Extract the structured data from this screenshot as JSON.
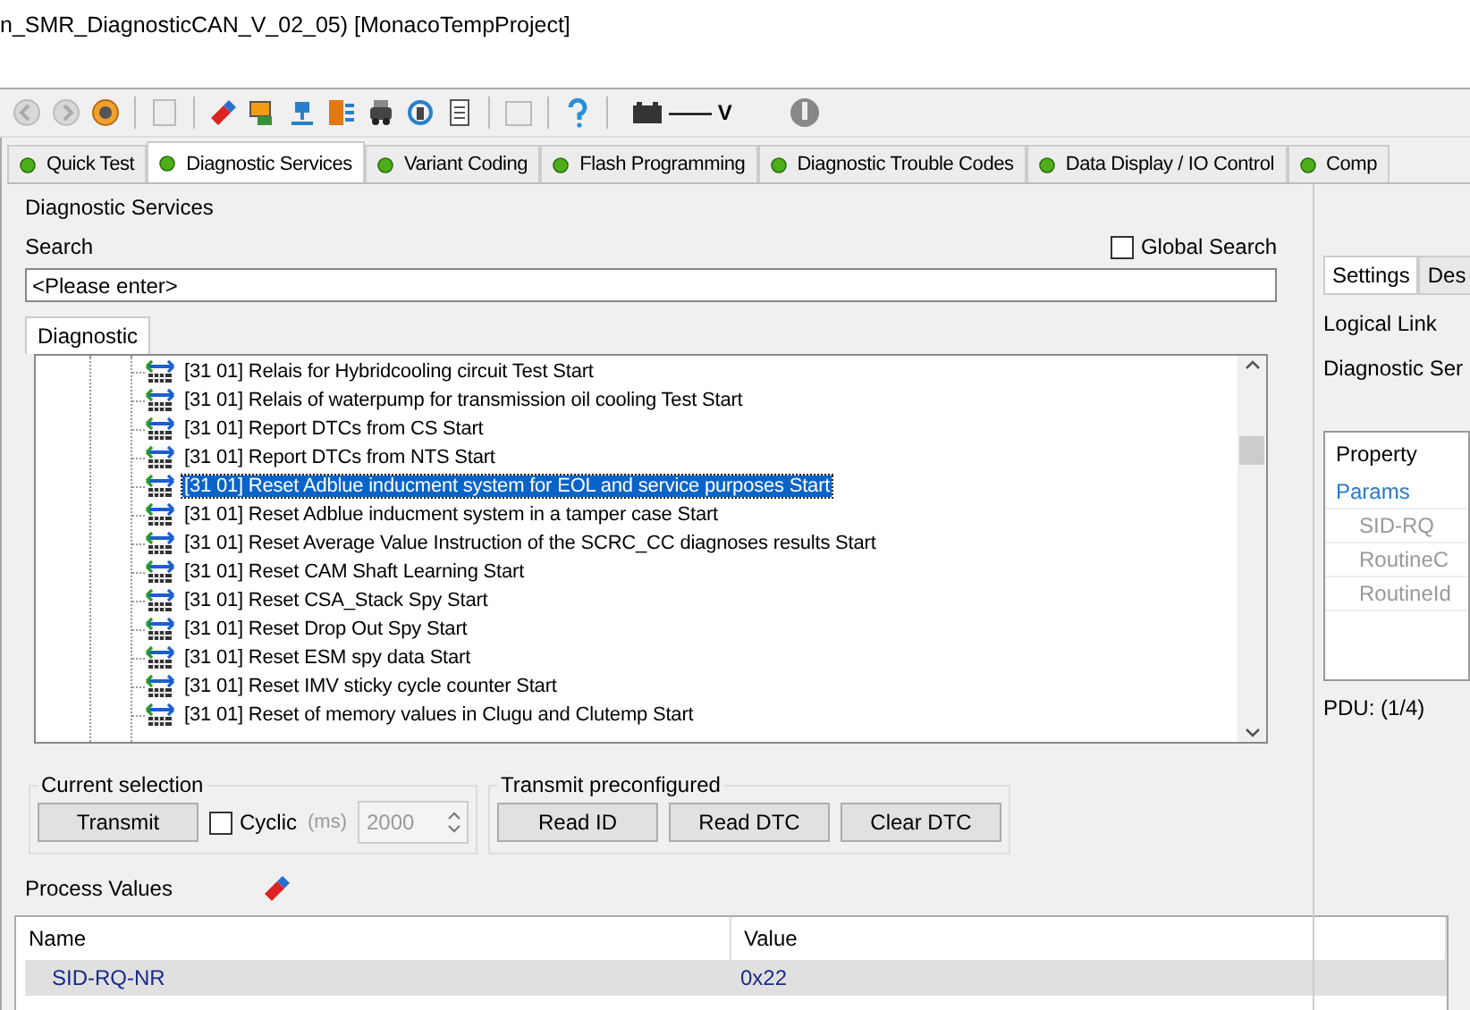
{
  "window": {
    "title": "n_SMR_DiagnosticCAN_V_02_05) [MonacoTempProject]"
  },
  "toolbar": {
    "battery_reading": "—— V"
  },
  "tabs": [
    {
      "label": "Quick Test",
      "selected": false
    },
    {
      "label": "Diagnostic Services",
      "selected": true
    },
    {
      "label": "Variant Coding",
      "selected": false
    },
    {
      "label": "Flash Programming",
      "selected": false
    },
    {
      "label": "Diagnostic Trouble Codes",
      "selected": false
    },
    {
      "label": "Data Display / IO Control",
      "selected": false
    },
    {
      "label": "Comp",
      "selected": false
    }
  ],
  "services": {
    "title": "Diagnostic Services",
    "search_label": "Search",
    "global_search": {
      "label": "Global Search",
      "checked": false
    },
    "search": {
      "placeholder": "<Please enter>"
    },
    "tree_tab": "Diagnostic",
    "items": [
      {
        "label": "[31 01] Relais for Hybridcooling circuit Test Start",
        "selected": false
      },
      {
        "label": "[31 01] Relais of waterpump for transmission oil cooling Test Start",
        "selected": false
      },
      {
        "label": "[31 01] Report DTCs from CS Start",
        "selected": false
      },
      {
        "label": "[31 01] Report DTCs from NTS Start",
        "selected": false
      },
      {
        "label": "[31 01] Reset Adblue inducment system for EOL and service purposes Start",
        "selected": true
      },
      {
        "label": "[31 01] Reset Adblue inducment system in a tamper case Start",
        "selected": false
      },
      {
        "label": "[31 01] Reset Average Value Instruction of the SCRC_CC diagnoses results Start",
        "selected": false
      },
      {
        "label": "[31 01] Reset CAM Shaft Learning Start",
        "selected": false
      },
      {
        "label": "[31 01] Reset CSA_Stack Spy Start",
        "selected": false
      },
      {
        "label": "[31 01] Reset Drop Out Spy Start",
        "selected": false
      },
      {
        "label": "[31 01] Reset ESM spy data Start",
        "selected": false
      },
      {
        "label": "[31 01] Reset IMV sticky cycle counter Start",
        "selected": false
      },
      {
        "label": "[31 01] Reset of memory values in Clugu and Clutemp Start",
        "selected": false
      }
    ]
  },
  "current_selection": {
    "title": "Current selection",
    "transmit": "Transmit",
    "cyclic": {
      "label": "Cyclic",
      "checked": false
    },
    "unit": "(ms)",
    "interval": "2000"
  },
  "transmit_preconfigured": {
    "title": "Transmit preconfigured",
    "buttons": [
      "Read ID",
      "Read DTC",
      "Clear DTC"
    ]
  },
  "process_values": {
    "title": "Process Values",
    "columns": [
      "Name",
      "Value"
    ],
    "rows": [
      {
        "name": "SID-RQ-NR",
        "value": "0x22"
      }
    ]
  },
  "side_panel": {
    "tabs": [
      {
        "label": "Settings",
        "selected": true
      },
      {
        "label": "Des",
        "selected": false
      }
    ],
    "fields": [
      "Logical Link",
      "Diagnostic Ser"
    ],
    "property_header": "Property",
    "properties": [
      {
        "label": "Params",
        "kind": "group"
      },
      {
        "label": "SID-RQ",
        "kind": "param"
      },
      {
        "label": "RoutineC",
        "kind": "param"
      },
      {
        "label": "RoutineId",
        "kind": "param"
      }
    ],
    "pdu": "PDU: (1/4)"
  }
}
